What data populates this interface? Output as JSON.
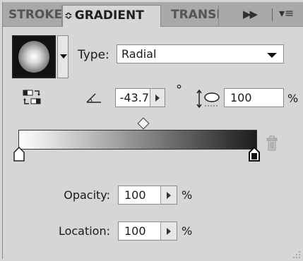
{
  "tabs": [
    {
      "label": "STROKE"
    },
    {
      "label": "GRADIENT",
      "active": true
    },
    {
      "label": "TRANSPARENCY"
    }
  ],
  "tabbar": {
    "sort_glyph": "≎",
    "more_glyph": "▶▶",
    "menu_glyph": "▾≡"
  },
  "gradient": {
    "type_label": "Type:",
    "type_value": "Radial",
    "angle_value": "-43.7",
    "degree_symbol": "°",
    "aspect_value": "100",
    "aspect_unit": "%",
    "opacity_label": "Opacity:",
    "opacity_value": "100",
    "opacity_unit": "%",
    "location_label": "Location:",
    "location_value": "100",
    "location_unit": "%"
  },
  "colors": {
    "panel_bg": "#d6d6d6",
    "tabbar_bg": "#a9a9a9",
    "gradient_start": "#ffffff",
    "gradient_end": "#1c1c1c"
  },
  "icons": {
    "reverse": "reverse-gradient-icon",
    "angle": "angle-icon",
    "aspect": "aspect-ratio-icon",
    "trash": "trash-icon"
  }
}
